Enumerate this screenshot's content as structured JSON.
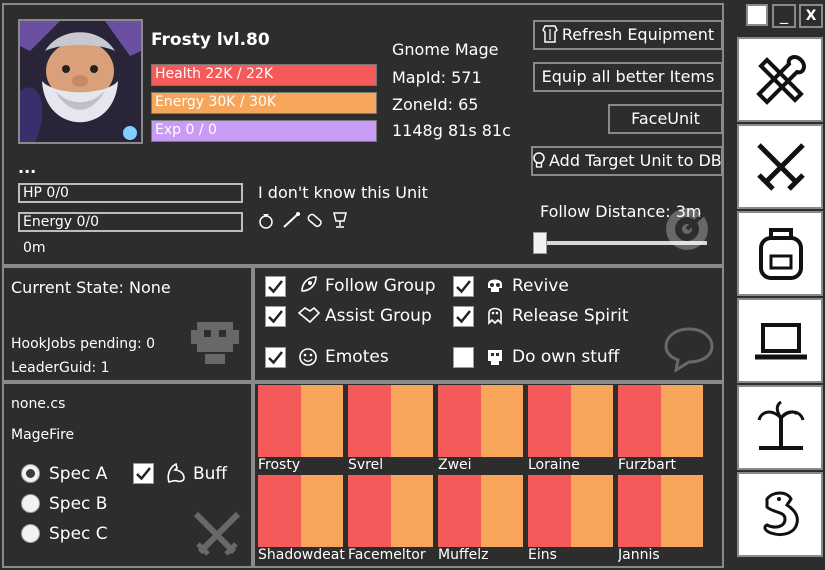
{
  "window_controls": {
    "minimize": "_",
    "close": "X"
  },
  "character": {
    "name": "Frosty lvl.80",
    "health": "Health 22K / 22K",
    "health_fraction": 1.0,
    "energy": "Energy 30K / 30K",
    "energy_fraction": 1.0,
    "exp": "Exp 0 / 0",
    "exp_fraction": 1.0,
    "class_race": "Gnome Mage",
    "map_id": "MapId: 571",
    "zone_id": "ZoneId: 65",
    "gold": "1148g 81s 81c"
  },
  "target": {
    "name": "...",
    "hp": "HP 0/0",
    "energy": "Energy 0/0",
    "distance": "0m",
    "status": "I don't know this Unit"
  },
  "buttons": {
    "refresh": "Refresh Equipment",
    "equip": "Equip all better Items",
    "face": "FaceUnit",
    "add_target": "Add Target Unit to DB"
  },
  "follow": {
    "label": "Follow Distance: 3m",
    "value_m": 3
  },
  "state": {
    "current": "Current State: None",
    "hookjobs": "HookJobs pending: 0",
    "leader": "LeaderGuid: 1"
  },
  "options": {
    "follow_group": {
      "label": "Follow Group",
      "checked": true
    },
    "assist_group": {
      "label": "Assist Group",
      "checked": true
    },
    "emotes": {
      "label": "Emotes",
      "checked": true
    },
    "revive": {
      "label": "Revive",
      "checked": true
    },
    "release_spirit": {
      "label": "Release Spirit",
      "checked": true
    },
    "do_own_stuff": {
      "label": "Do own stuff",
      "checked": false
    }
  },
  "combat": {
    "file": "none.cs",
    "profile": "MageFire",
    "spec_a": "Spec A",
    "spec_b": "Spec B",
    "spec_c": "Spec C",
    "selected_spec": "Spec A",
    "buff": "Buff",
    "buff_checked": true
  },
  "party": [
    {
      "name": "Frosty"
    },
    {
      "name": "Svrel"
    },
    {
      "name": "Zwei"
    },
    {
      "name": "Loraine"
    },
    {
      "name": "Furzbart"
    },
    {
      "name": "Shadowdeath"
    },
    {
      "name": "Facemeltor"
    },
    {
      "name": "Muffelz"
    },
    {
      "name": "Eins"
    },
    {
      "name": "Jannis"
    }
  ],
  "colors": {
    "background": "#2d2d2d",
    "border": "#8a8a8a",
    "health": "#f55a5a",
    "energy": "#f7a55a",
    "exp": "#c89bf5"
  },
  "icons": {
    "nav": [
      "tools-icon",
      "crossed-swords-icon",
      "backpack-icon",
      "laptop-icon",
      "palm-tree-icon",
      "dragon-icon"
    ]
  }
}
